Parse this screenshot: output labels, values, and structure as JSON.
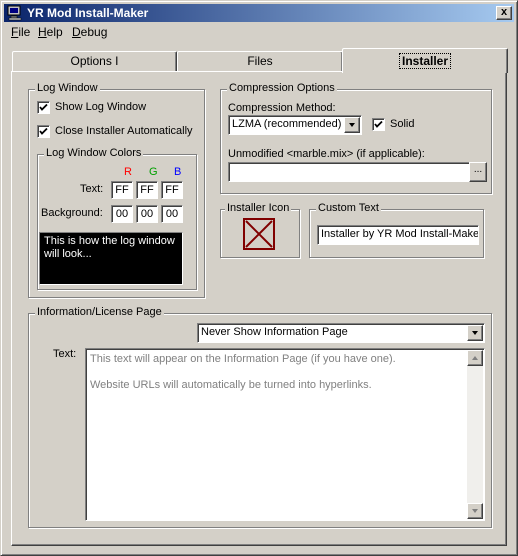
{
  "window": {
    "title": "YR Mod Install-Maker",
    "close_glyph": "x"
  },
  "menu": {
    "file": "File",
    "help": "Help",
    "debug": "Debug"
  },
  "tabs": [
    {
      "label": "Options I",
      "active": false
    },
    {
      "label": "Files",
      "active": false
    },
    {
      "label": "Installer",
      "active": true
    }
  ],
  "log_window": {
    "group_label": "Log Window",
    "show_log": {
      "label": "Show Log Window",
      "checked": true
    },
    "close_auto": {
      "label": "Close Installer Automatically",
      "checked": true
    },
    "colors": {
      "group_label": "Log Window Colors",
      "r_header": "R",
      "g_header": "G",
      "b_header": "B",
      "text_label": "Text:",
      "background_label": "Background:",
      "text_rgb": [
        "FF",
        "FF",
        "FF"
      ],
      "background_rgb": [
        "00",
        "00",
        "00"
      ]
    },
    "preview_text_line1": "This is how the log window",
    "preview_text_line2": "will look..."
  },
  "compression": {
    "group_label": "Compression Options",
    "method_label": "Compression Method:",
    "method_value": "LZMA (recommended)",
    "solid": {
      "label": "Solid",
      "checked": true
    },
    "unmodified_label": "Unmodified <marble.mix> (if applicable):",
    "unmodified_value": "",
    "browse_label": "..."
  },
  "installer_icon": {
    "group_label": "Installer Icon"
  },
  "custom_text": {
    "group_label": "Custom Text",
    "value": "Installer by YR Mod Install-Maker"
  },
  "info_page": {
    "group_label": "Information/License Page",
    "dropdown_value": "Never Show Information Page",
    "text_label": "Text:",
    "placeholder_line1": "This text will appear on the Information Page (if you have one).",
    "placeholder_line2": "Website URLs will automatically be turned into hyperlinks."
  },
  "colors": {
    "title_gradient_start": "#0a246a",
    "title_gradient_end": "#a6caf0",
    "r_header": "#ff0000",
    "g_header": "#00a000",
    "b_header": "#0000ff",
    "icon_border": "#800000"
  }
}
